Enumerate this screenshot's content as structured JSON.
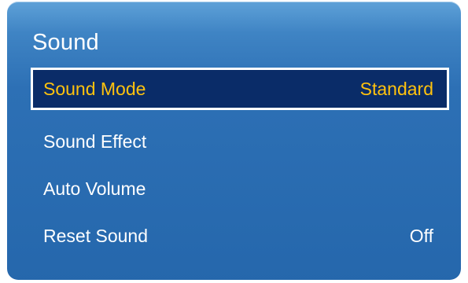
{
  "menu": {
    "title": "Sound",
    "items": [
      {
        "label": "Sound Mode",
        "value": "Standard",
        "selected": true
      },
      {
        "label": "Sound Effect",
        "value": ""
      },
      {
        "label": "Auto Volume",
        "value": ""
      },
      {
        "label": "Reset Sound",
        "value": "Off"
      }
    ]
  },
  "colors": {
    "panel_background": "#2567ac",
    "selected_background": "#0a2c68",
    "selected_text": "#ffc20e",
    "text": "#ffffff"
  }
}
